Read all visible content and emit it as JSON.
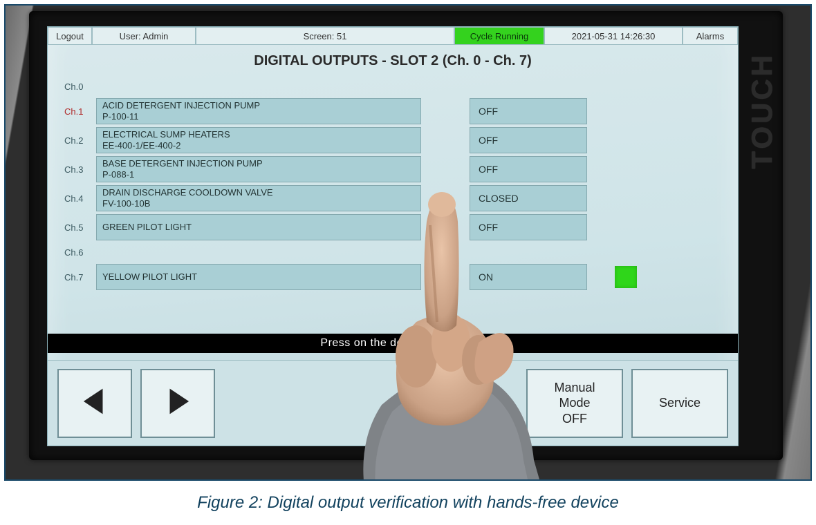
{
  "topbar": {
    "logout": "Logout",
    "user": "User: Admin",
    "screen": "Screen: 51",
    "status": "Cycle Running",
    "datetime": "2021-05-31 14:26:30",
    "alarms": "Alarms"
  },
  "title": "DIGITAL OUTPUTS - SLOT 2 (Ch. 0 - Ch. 7)",
  "channels": [
    {
      "id": "Ch.0",
      "desc_line1": "",
      "desc_line2": "",
      "state": "",
      "empty": true
    },
    {
      "id": "Ch.1",
      "desc_line1": "ACID DETERGENT INJECTION PUMP",
      "desc_line2": "P-100-11",
      "state": "OFF",
      "highlight": true
    },
    {
      "id": "Ch.2",
      "desc_line1": "ELECTRICAL SUMP HEATERS",
      "desc_line2": "EE-400-1/EE-400-2",
      "state": "OFF"
    },
    {
      "id": "Ch.3",
      "desc_line1": "BASE DETERGENT INJECTION PUMP",
      "desc_line2": "P-088-1",
      "state": "OFF"
    },
    {
      "id": "Ch.4",
      "desc_line1": "DRAIN DISCHARGE COOLDOWN VALVE",
      "desc_line2": "FV-100-10B",
      "state": "CLOSED"
    },
    {
      "id": "Ch.5",
      "desc_line1": "GREEN PILOT LIGHT",
      "desc_line2": "",
      "state": "OFF"
    },
    {
      "id": "Ch.6",
      "desc_line1": "",
      "desc_line2": "",
      "state": "",
      "empty": true
    },
    {
      "id": "Ch.7",
      "desc_line1": "YELLOW PILOT LIGHT",
      "desc_line2": "",
      "state": "ON",
      "indicator_on": true
    }
  ],
  "instruction": "Press on the desired output",
  "bottom": {
    "manual_mode": "Manual\nMode\nOFF",
    "service": "Service"
  },
  "bezel_brand": "TOUCH",
  "caption": "Figure 2: Digital output verification with hands-free device"
}
